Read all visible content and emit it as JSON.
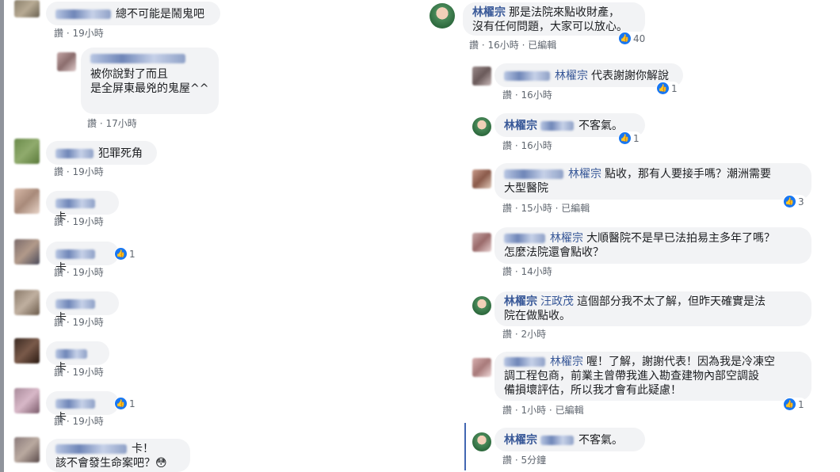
{
  "left_comments": [
    {
      "text": "總不可能是鬧鬼吧",
      "like": "讚",
      "time": "19小時"
    },
    {
      "text1": "被你說對了而且",
      "text2": "是全屏東最兇的鬼屋^^",
      "like": "讚",
      "time": "17小時"
    },
    {
      "text": "犯罪死角",
      "like": "讚",
      "time": "19小時"
    },
    {
      "text": "卡",
      "like": "讚",
      "time": "19小時"
    },
    {
      "text": "卡",
      "like": "讚",
      "time": "19小時",
      "reactions": "1"
    },
    {
      "text": "卡",
      "like": "讚",
      "time": "19小時"
    },
    {
      "text": "卡",
      "like": "讚",
      "time": "19小時"
    },
    {
      "text": "卡",
      "like": "讚",
      "time": "19小時",
      "reactions": "1"
    },
    {
      "text1": "卡！",
      "text2": "該不會發生命案吧？😳"
    }
  ],
  "right_comments": [
    {
      "name": "林櫂宗",
      "text1": "那是法院來點收財產，",
      "text2": "沒有任何問題，大家可以放心。",
      "like": "讚",
      "time": "16小時",
      "edited": "已編輯",
      "reactions": "40"
    },
    {
      "tag": "林櫂宗",
      "text": "代表謝謝你解說",
      "like": "讚",
      "time": "16小時",
      "reactions": "1"
    },
    {
      "name": "林櫂宗",
      "text": "不客氣。",
      "like": "讚",
      "time": "16小時",
      "reactions": "1"
    },
    {
      "tag": "林櫂宗",
      "text1": "點收，那有人要接手嗎？潮洲需要",
      "text2": "大型醫院",
      "like": "讚",
      "time": "15小時",
      "edited": "已編輯",
      "reactions": "3"
    },
    {
      "tag": "林櫂宗",
      "text1": "大順醫院不是早已法拍易主多年了嗎？",
      "text2": "怎麼法院還會點收？",
      "like": "讚",
      "time": "14小時"
    },
    {
      "name": "林櫂宗",
      "tag": "汪政茂",
      "text1": "這個部分我不太了解，但昨天確實是法",
      "text2": "院在做點收。",
      "like": "讚",
      "time": "2小時"
    },
    {
      "tag": "林櫂宗",
      "text1": "喔！了解，謝謝代表！因為我是冷凍空",
      "text2": "調工程包商，前業主曾帶我進入勘查建物內部空調設",
      "text3": "備損壞評估，所以我才會有此疑慮！",
      "like": "讚",
      "time": "1小時",
      "edited": "已編輯",
      "reactions": "1"
    },
    {
      "name": "林櫂宗",
      "text": "不客氣。",
      "like": "讚",
      "time": "5分鐘"
    }
  ]
}
